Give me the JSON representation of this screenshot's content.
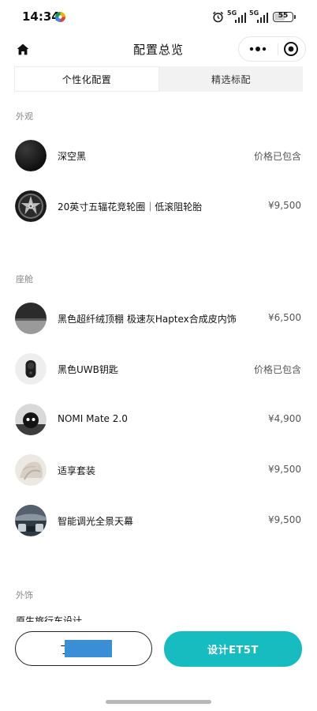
{
  "status_bar": {
    "time": "14:34",
    "network_1": "5G",
    "network_2": "5G",
    "battery": "55",
    "battery_level": 0.55
  },
  "nav": {
    "title": "配置总览"
  },
  "tabs": [
    {
      "label": "个性化配置",
      "active": true
    },
    {
      "label": "精选标配",
      "active": false
    }
  ],
  "sections": {
    "exterior": {
      "title": "外观",
      "items": [
        {
          "name": "深空黑",
          "price": "价格已包含",
          "thumb": "black-paint-swatch"
        },
        {
          "name": "20英寸五辐花竞轮圈｜低滚阻轮胎",
          "price": "¥9,500",
          "thumb": "wheel-rim"
        }
      ]
    },
    "cabin": {
      "title": "座舱",
      "items": [
        {
          "name": "黑色超纤绒顶棚 极速灰Haptex合成皮内饰",
          "price": "¥6,500",
          "thumb": "interior-swatch"
        },
        {
          "name": "黑色UWB钥匙",
          "price": "价格已包含",
          "thumb": "uwb-key"
        },
        {
          "name": "NOMI Mate 2.0",
          "price": "¥4,900",
          "thumb": "nomi-mate"
        },
        {
          "name": "适享套装",
          "price": "¥9,500",
          "thumb": "comfort-package"
        },
        {
          "name": "智能调光全景天幕",
          "price": "¥9,500",
          "thumb": "panoramic-roof"
        }
      ]
    },
    "exterior_accessories": {
      "title": "外饰",
      "partial_text": "原生旅行车设计"
    }
  },
  "bottom": {
    "left_button_label": "了",
    "right_button_label": "设计ET5T"
  },
  "colors": {
    "accent": "#16bcc0",
    "redaction": "#3a8ed6"
  }
}
